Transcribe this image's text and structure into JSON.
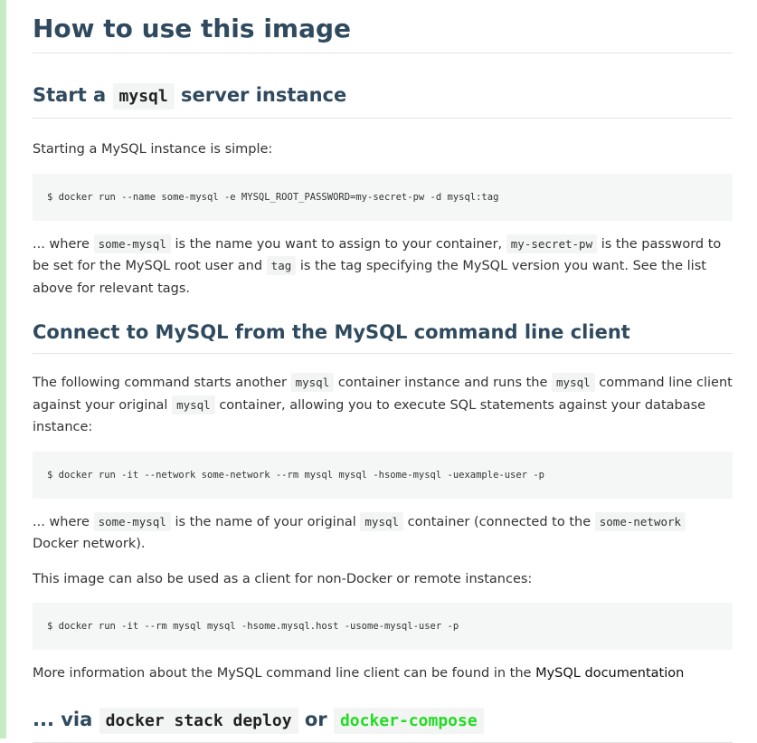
{
  "page": {
    "title": "How to use this image",
    "section_start": {
      "heading_pre": "Start a",
      "heading_code": "mysql",
      "heading_post": "server instance",
      "intro": "Starting a MySQL instance is simple:",
      "command": "$ docker run --name some-mysql -e MYSQL_ROOT_PASSWORD=my-secret-pw -d mysql:tag",
      "where_1": "... where",
      "code_1": "some-mysql",
      "where_2": "is the name you want to assign to your container,",
      "code_2": "my-secret-pw",
      "where_3": "is the password to be set for the MySQL root user and",
      "code_3": "tag",
      "where_4": "is the tag specifying the MySQL version you want. See the list above for relevant tags."
    },
    "section_connect": {
      "heading": "Connect to MySQL from the MySQL command line client",
      "p1_a": "The following command starts another",
      "p1_code1": "mysql",
      "p1_b": "container instance and runs the",
      "p1_code2": "mysql",
      "p1_c": "command line client against your original",
      "p1_code3": "mysql",
      "p1_d": "container, allowing you to execute SQL statements against your database instance:",
      "command1": "$ docker run -it --network some-network --rm mysql mysql -hsome-mysql -uexample-user -p",
      "p2_a": "... where",
      "p2_code1": "some-mysql",
      "p2_b": "is the name of your original",
      "p2_code2": "mysql",
      "p2_c": "container (connected to the",
      "p2_code3": "some-network",
      "p2_d": "Docker network).",
      "p3": "This image can also be used as a client for non-Docker or remote instances:",
      "command2": "$ docker run -it --rm mysql mysql -hsome.mysql.host -usome-mysql-user -p",
      "p4": "More information about the MySQL command line client can be found in the",
      "p4_link": "MySQL documentation"
    },
    "section_via": {
      "heading_pre": "... via",
      "heading_code1": "docker stack deploy",
      "heading_mid": "or",
      "heading_code2": "docker-compose"
    }
  },
  "colors": {
    "heading": "#2f4a5e",
    "left_stripe": "#c7ecc4",
    "compose_green": "#22dd22"
  }
}
